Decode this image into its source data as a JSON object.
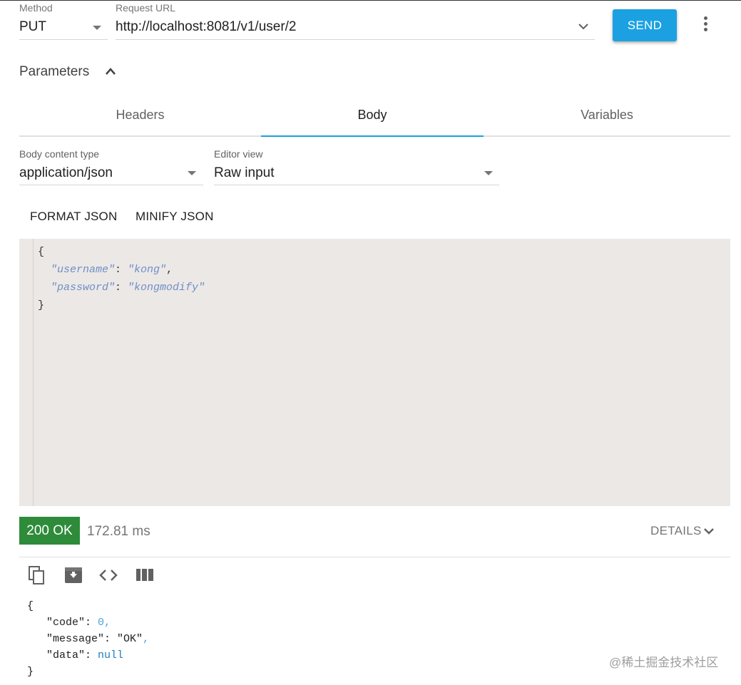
{
  "request": {
    "method_label": "Method",
    "method_value": "PUT",
    "url_label": "Request URL",
    "url_value": "http://localhost:8081/v1/user/2",
    "send_label": "SEND",
    "more_icon": "more-vert-icon"
  },
  "parameters": {
    "title": "Parameters",
    "toggle_icon": "chevron-up-icon"
  },
  "tabs": [
    {
      "label": "Headers",
      "active": false
    },
    {
      "label": "Body",
      "active": true
    },
    {
      "label": "Variables",
      "active": false
    }
  ],
  "body_options": {
    "content_type_label": "Body content type",
    "content_type_value": "application/json",
    "editor_view_label": "Editor view",
    "editor_view_value": "Raw input",
    "format_label": "FORMAT JSON",
    "minify_label": "MINIFY JSON"
  },
  "editor": {
    "open_brace": "{",
    "lines": [
      {
        "key": "\"username\"",
        "sep": ": ",
        "value": "\"kong\"",
        "tail": ","
      },
      {
        "key": "\"password\"",
        "sep": ": ",
        "value": "\"kongmodify\"",
        "tail": ""
      }
    ],
    "close_brace": "}"
  },
  "response": {
    "status": "200 OK",
    "status_color": "#2e8b3a",
    "timing": "172.81 ms",
    "details_label": "DETAILS",
    "toolbar_icons": [
      "copy-icon",
      "save-icon",
      "code-view-icon",
      "columns-icon"
    ],
    "open_brace": "{",
    "lines": [
      {
        "key": "\"code\"",
        "sep": ": ",
        "value": "0",
        "tail": ","
      },
      {
        "key": "\"message\"",
        "sep": ": ",
        "value": "\"OK\"",
        "tail": ","
      },
      {
        "key": "\"data\"",
        "sep": ": ",
        "value": "null",
        "tail": ""
      }
    ],
    "close_brace": "}"
  },
  "watermark": "@稀土掘金技术社区",
  "colors": {
    "accent": "#1ba1e2",
    "editor_bg": "#ece8e6"
  }
}
